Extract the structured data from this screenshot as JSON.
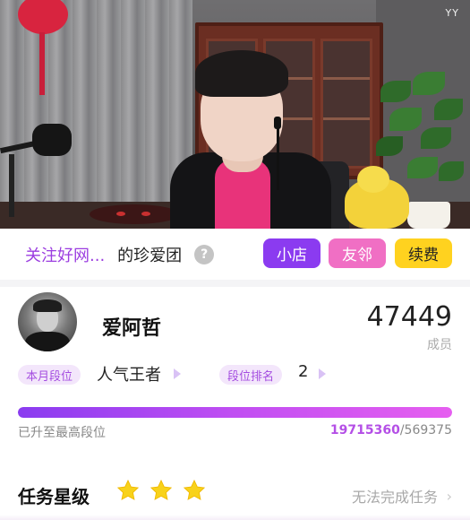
{
  "stream": {
    "watermark": "YY"
  },
  "club_bar": {
    "anchor_name": "关注好网...",
    "club_suffix": "的珍爱团",
    "help_label": "?",
    "buttons": {
      "shop": "小店",
      "neighbor": "友邻",
      "renew": "续费"
    }
  },
  "profile": {
    "username": "爱阿哲",
    "member_count": "47449",
    "member_label": "成员"
  },
  "rank": {
    "month_tag": "本月段位",
    "month_value": "人气王者",
    "rank_tag": "段位排名",
    "rank_value": "2"
  },
  "progress": {
    "note": "已升至最高段位",
    "current": "19715360",
    "separator": "/",
    "target": "569375",
    "fill_fraction": 1.0
  },
  "task": {
    "title": "任务星级",
    "stars": 3,
    "status": "无法完成任务",
    "chevron": "›"
  },
  "colors": {
    "purple": "#8b3bf0",
    "pink": "#f06fc4",
    "yellow": "#ffd21f",
    "star": "#f8d21a"
  }
}
